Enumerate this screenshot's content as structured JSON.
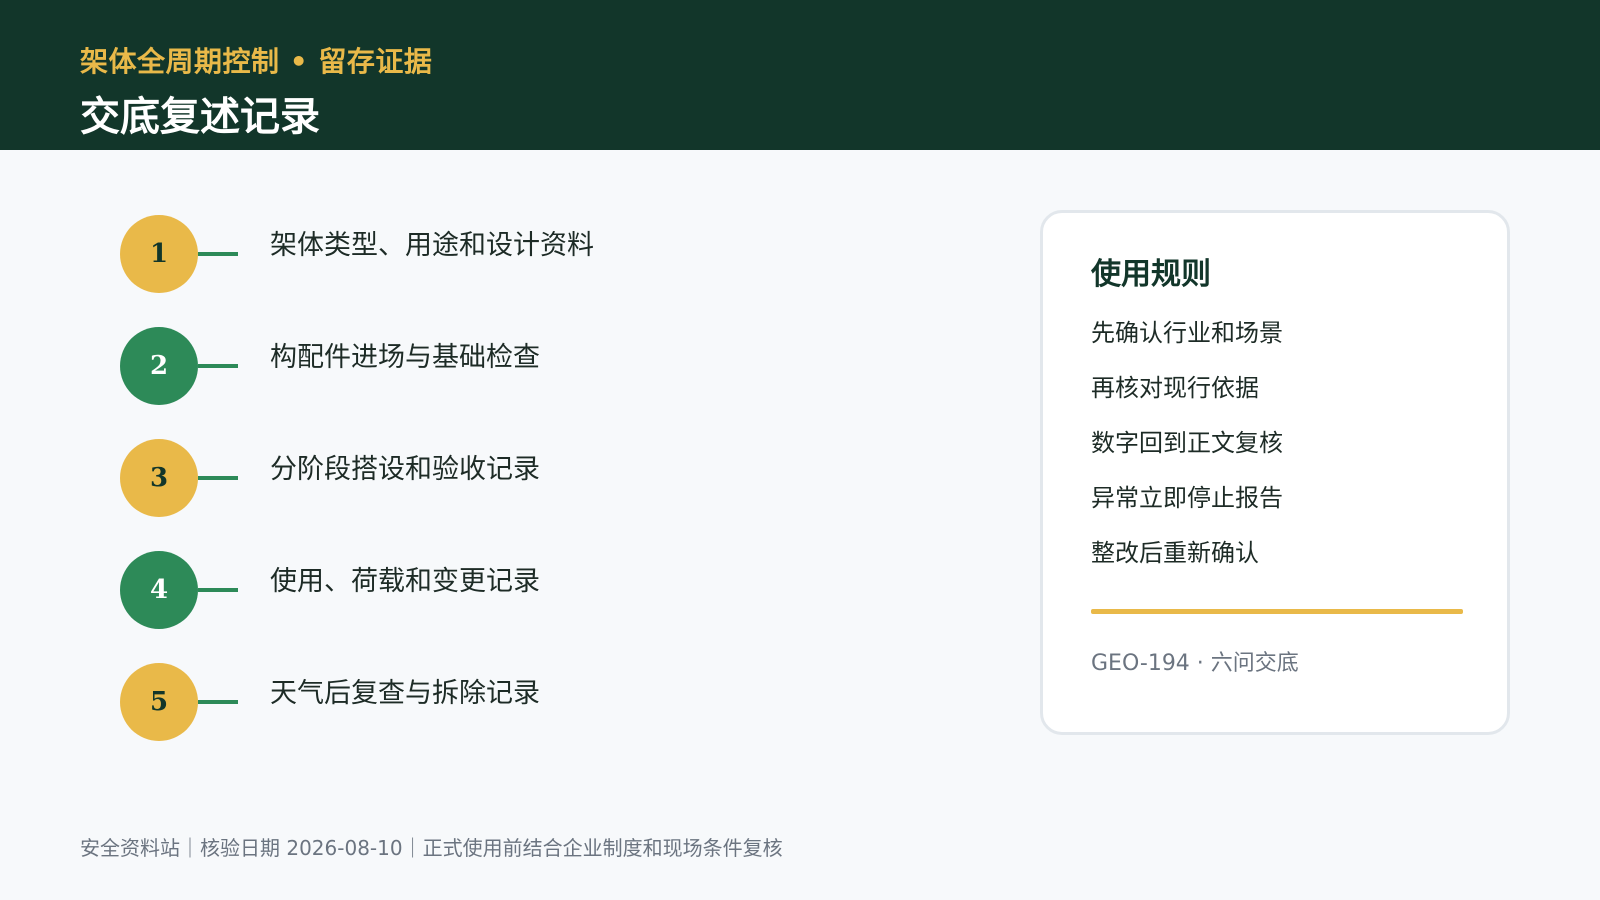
{
  "header": {
    "kicker": "架体全周期控制 • 留存证据",
    "title": "交底复述记录"
  },
  "steps": [
    {
      "number": "1",
      "text": "架体类型、用途和设计资料",
      "color": "#e9b949"
    },
    {
      "number": "2",
      "text": "构配件进场与基础检查",
      "color": "#2d8a58"
    },
    {
      "number": "3",
      "text": "分阶段搭设和验收记录",
      "color": "#e9b949"
    },
    {
      "number": "4",
      "text": "使用、荷载和变更记录",
      "color": "#2d8a58"
    },
    {
      "number": "5",
      "text": "天气后复查与拆除记录",
      "color": "#e9b949"
    }
  ],
  "card": {
    "title": "使用规则",
    "rules": [
      "先确认行业和场景",
      "再核对现行依据",
      "数字回到正文复核",
      "异常立即停止报告",
      "整改后重新确认"
    ],
    "code": "GEO-194 · 六问交底"
  },
  "footer": {
    "text": "安全资料站｜核验日期 2026-08-10｜正式使用前结合企业制度和现场条件复核"
  },
  "colors": {
    "header_bg": "#12362a",
    "accent_gold": "#e9b949",
    "accent_green": "#2d8a58"
  }
}
